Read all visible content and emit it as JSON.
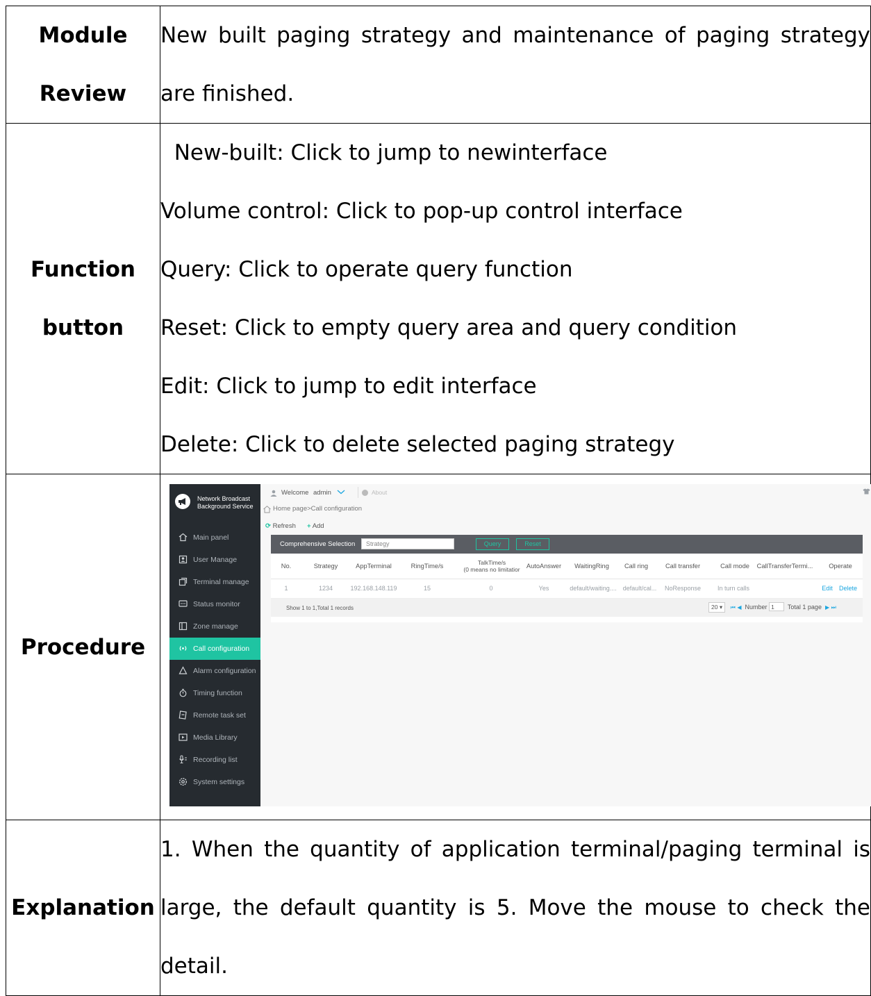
{
  "rows": {
    "module_review": {
      "label_line1": "Module",
      "label_line2": "Review",
      "text": "New built paging strategy and maintenance of paging strategy are finished."
    },
    "function_button": {
      "label_line1": "Function",
      "label_line2": "button",
      "items": [
        "  New-built: Click to jump to newinterface",
        "Volume control: Click to pop-up control interface",
        "Query: Click to operate query function",
        "Reset: Click to empty query area and query condition",
        "Edit: Click to jump to edit interface",
        "Delete: Click to delete selected paging strategy"
      ]
    },
    "procedure": {
      "label": "Procedure"
    },
    "explanation": {
      "label": "Explanation",
      "text": "1. When the quantity of application terminal/paging terminal is large, the default quantity is 5. Move the mouse to check the detail."
    }
  },
  "app": {
    "brand_line1": "Network Broadcast",
    "brand_line2": "Background Service",
    "nav": [
      {
        "label": "Main panel",
        "icon": "home-icon"
      },
      {
        "label": "User Manage",
        "icon": "user-card-icon"
      },
      {
        "label": "Terminal manage",
        "icon": "terminal-icon"
      },
      {
        "label": "Status monitor",
        "icon": "monitor-icon"
      },
      {
        "label": "Zone manage",
        "icon": "zone-icon"
      },
      {
        "label": "Call configuration",
        "icon": "broadcast-icon"
      },
      {
        "label": "Alarm configuration",
        "icon": "bell-icon"
      },
      {
        "label": "Timing function",
        "icon": "stopwatch-icon"
      },
      {
        "label": "Remote task set",
        "icon": "remote-icon"
      },
      {
        "label": "Media Library",
        "icon": "media-icon"
      },
      {
        "label": "Recording list",
        "icon": "microphone-icon"
      },
      {
        "label": "System settings",
        "icon": "gear-icon"
      }
    ],
    "active_nav": "Call configuration",
    "welcome": "Welcome",
    "user": "admin",
    "about": "About",
    "breadcrumb": "Home page>Call configuration",
    "refresh": "Refresh",
    "add": "Add",
    "query_label": "Comprehensive Selection",
    "query_placeholder": "Strategy",
    "query_btn": "Query",
    "reset_btn": "Reset",
    "columns": [
      "No.",
      "Strategy",
      "AppTerminal",
      "RingTime/s",
      "TalkTime/s",
      "(0 means no limitatior",
      "AutoAnswer",
      "WaitingRing",
      "Call ring",
      "Call transfer",
      "Call mode",
      "CallTransferTermi...",
      "Operate"
    ],
    "row": {
      "no": "1",
      "strategy": "1234",
      "app_terminal": "192.168.148.119",
      "ring_time": "15",
      "talk_time": "0",
      "auto_answer": "Yes",
      "waiting_ring": "default/waiting....",
      "call_ring": "default/cal...",
      "call_transfer": "NoResponse",
      "call_mode": "In turn calls",
      "edit": "Edit",
      "delete": "Delete"
    },
    "footer_info": "Show 1 to 1,Total 1 records",
    "page_size": "20",
    "number_label": "Number",
    "page_number": "1",
    "total_pages": "Total 1 page",
    "colors": {
      "sidebar": "#262b30",
      "accent": "#1fc4a2",
      "link": "#1aa6e0",
      "query_bar": "#5a5d63"
    }
  }
}
